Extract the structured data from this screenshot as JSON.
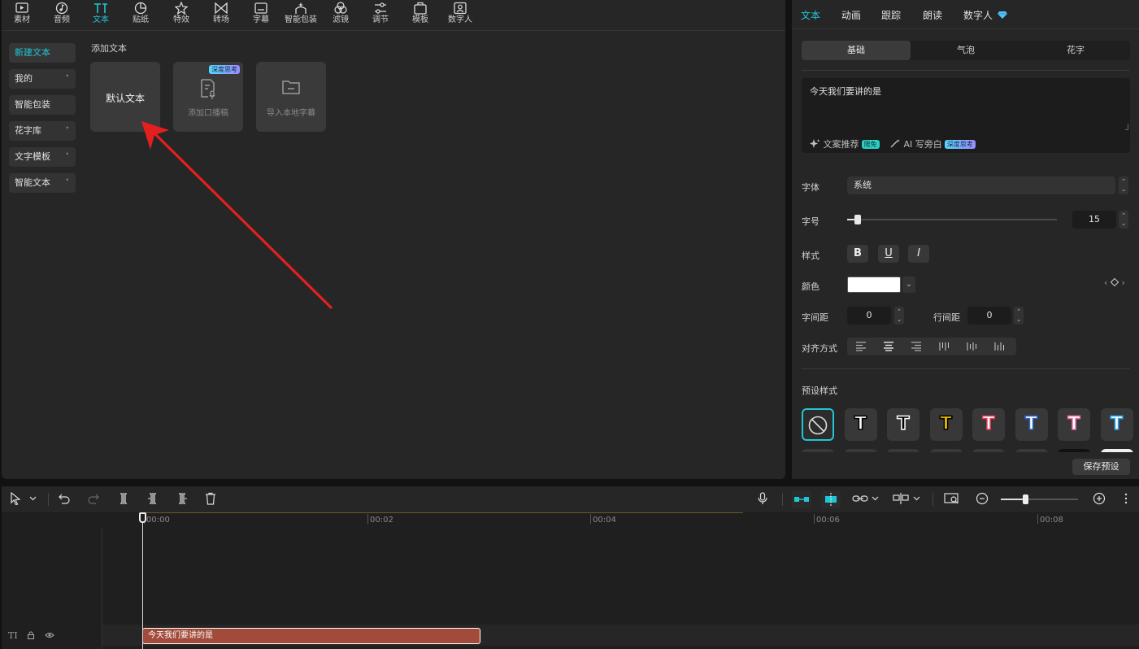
{
  "top_tabs": [
    {
      "label": "素材",
      "icon": "media-icon"
    },
    {
      "label": "音频",
      "icon": "audio-icon"
    },
    {
      "label": "文本",
      "icon": "text-icon",
      "active": true
    },
    {
      "label": "贴纸",
      "icon": "sticker-icon"
    },
    {
      "label": "特效",
      "icon": "effects-icon"
    },
    {
      "label": "转场",
      "icon": "transition-icon"
    },
    {
      "label": "字幕",
      "icon": "subtitle-icon"
    },
    {
      "label": "智能包装",
      "icon": "smart-pack-icon"
    },
    {
      "label": "滤镜",
      "icon": "filter-icon"
    },
    {
      "label": "调节",
      "icon": "adjust-icon"
    },
    {
      "label": "模板",
      "icon": "template-icon"
    },
    {
      "label": "数字人",
      "icon": "digital-human-icon"
    }
  ],
  "side_menu": [
    {
      "label": "新建文本",
      "active": true
    },
    {
      "label": "我的",
      "chevron": "˅"
    },
    {
      "label": "智能包装"
    },
    {
      "label": "花字库",
      "chevron": "˅"
    },
    {
      "label": "文字模板",
      "chevron": "˅"
    },
    {
      "label": "智能文本",
      "chevron": "˅"
    }
  ],
  "section_title": "添加文本",
  "cards": {
    "default_text": "默认文本",
    "teleprompter": "添加口播稿",
    "teleprompter_badge": "深度思考",
    "import_subtitle": "导入本地字幕"
  },
  "right_tabs": [
    "文本",
    "动画",
    "跟踪",
    "朗读",
    "数字人"
  ],
  "segments": [
    "基础",
    "气泡",
    "花字"
  ],
  "text_content": "今天我们要讲的是",
  "text_tools": {
    "recommend": "文案推荐",
    "recommend_badge": "限免",
    "ai_write": "AI 写旁白",
    "ai_badge": "深度思考"
  },
  "props": {
    "font_label": "字体",
    "font_value": "系统",
    "size_label": "字号",
    "size_value": "15",
    "size_fraction": 0.05,
    "style_label": "样式",
    "style_buttons": [
      "B",
      "U",
      "I"
    ],
    "color_label": "颜色",
    "color_value": "#ffffff",
    "letter_spacing_label": "字间距",
    "letter_spacing_value": "0",
    "line_spacing_label": "行间距",
    "line_spacing_value": "0",
    "align_label": "对齐方式"
  },
  "preset_label": "预设样式",
  "presets": [
    {
      "type": "none"
    },
    {
      "fill": "#ffffff",
      "stroke": "#000000"
    },
    {
      "fill": "#000000",
      "stroke": "#ffffff"
    },
    {
      "fill": "#f5c400",
      "stroke": "#000000"
    },
    {
      "fill": "#ffffff",
      "stroke": "#e83a5a"
    },
    {
      "fill": "#ffffff",
      "stroke": "#2a62c8"
    },
    {
      "fill": "#ffffff",
      "stroke": "#f06fa8"
    },
    {
      "fill": "#ffffff",
      "stroke": "#2aa3e8"
    }
  ],
  "save_preset": "保存预设",
  "timeline": {
    "ticks": [
      "00:00",
      "00:02",
      "00:04",
      "00:06",
      "00:08"
    ],
    "clip_text": "今天我们要讲的是",
    "track_label": "TI"
  },
  "colors": {
    "accent": "#22c5d6",
    "clip": "#a24b3a",
    "arrow": "#e32020"
  }
}
